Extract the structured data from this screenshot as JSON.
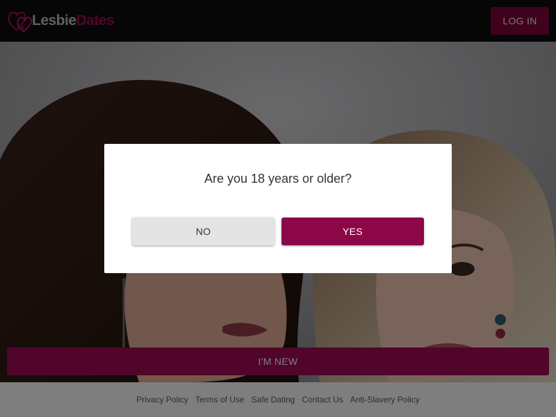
{
  "header": {
    "logo": {
      "text_a": "Lesbie",
      "text_b": "Dates",
      "icon": "hearts-icon"
    },
    "login_label": "LOG IN"
  },
  "hero": {
    "new_label": "I'M NEW"
  },
  "footer": {
    "links": [
      "Privacy Policy",
      "Terms of Use",
      "Safe Dating",
      "Contact Us",
      "Anti-Slavery Policy"
    ]
  },
  "age_modal": {
    "question": "Are you 18 years or older?",
    "no_label": "NO",
    "yes_label": "YES"
  },
  "colors": {
    "brand": "#9b0a52",
    "header_bg": "#0d0d0d"
  }
}
